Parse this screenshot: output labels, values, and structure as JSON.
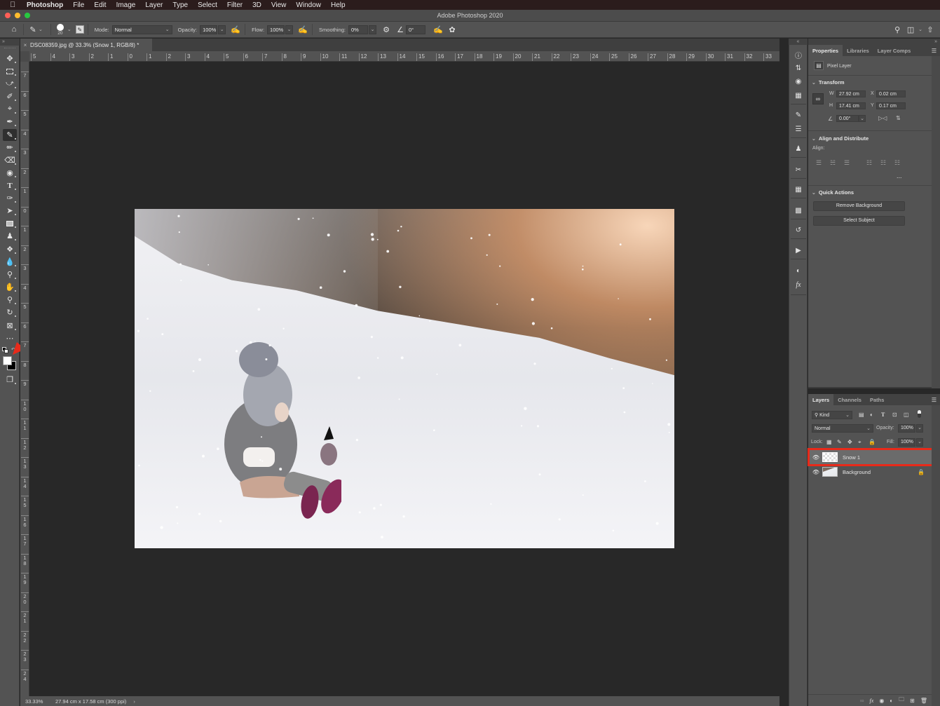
{
  "menubar": {
    "apple_icon": "apple-logo",
    "app_name": "Photoshop",
    "items": [
      "File",
      "Edit",
      "Image",
      "Layer",
      "Type",
      "Select",
      "Filter",
      "3D",
      "View",
      "Window",
      "Help"
    ]
  },
  "window": {
    "title": "Adobe Photoshop 2020",
    "traffic_lights": {
      "close": "#fe5f57",
      "minimize": "#febc2e",
      "zoom": "#28c840"
    }
  },
  "options_bar": {
    "brush_size": "20",
    "mode_label": "Mode:",
    "mode_value": "Normal",
    "opacity_label": "Opacity:",
    "opacity_value": "100%",
    "flow_label": "Flow:",
    "flow_value": "100%",
    "smoothing_label": "Smoothing:",
    "smoothing_value": "0%",
    "angle_value": "0°"
  },
  "document": {
    "tab_title": "DSC08359.jpg @ 33.3% (Snow 1, RGB/8) *",
    "close_glyph": "×"
  },
  "rulers": {
    "top": [
      "5",
      "4",
      "3",
      "2",
      "1",
      "0",
      "1",
      "2",
      "3",
      "4",
      "5",
      "6",
      "7",
      "8",
      "9",
      "10",
      "11",
      "12",
      "13",
      "14",
      "15",
      "16",
      "17",
      "18",
      "19",
      "20",
      "21",
      "22",
      "23",
      "24",
      "25",
      "26",
      "27",
      "28",
      "29",
      "30",
      "31",
      "32",
      "33"
    ],
    "left": [
      "7",
      "6",
      "5",
      "4",
      "3",
      "2",
      "1",
      "0",
      "1",
      "2",
      "3",
      "4",
      "5",
      "6",
      "7",
      "8",
      "9",
      "10",
      "11",
      "12",
      "13",
      "14",
      "15",
      "16",
      "17",
      "18",
      "19",
      "20",
      "21",
      "22",
      "23",
      "24"
    ]
  },
  "tools": [
    "move",
    "marquee",
    "lasso",
    "quick-select",
    "crop",
    "eyedropper",
    "brush",
    "history-brush",
    "eraser",
    "paint-bucket",
    "type",
    "pen",
    "path-select",
    "rectangle",
    "clone-stamp",
    "patch",
    "blur",
    "dodge",
    "hand",
    "zoom",
    "rotate-view",
    "frame",
    "more-tools",
    "default-colors",
    "foreground-background-colors",
    "screen-mode"
  ],
  "colors": {
    "foreground": "#ffffff",
    "background": "#000000",
    "annotation_red": "#e82a1a"
  },
  "status_bar": {
    "zoom": "33.33%",
    "doc_info": "27.94 cm x 17.58 cm (300 ppi)",
    "arrow": "›"
  },
  "properties_panel": {
    "tabs": [
      "Properties",
      "Libraries",
      "Layer Comps"
    ],
    "active_tab": "Properties",
    "layer_type": "Pixel Layer",
    "transform": {
      "title": "Transform",
      "w_label": "W",
      "w_value": "27.92 cm",
      "h_label": "H",
      "h_value": "17.41 cm",
      "x_label": "X",
      "x_value": "0.02 cm",
      "y_label": "Y",
      "y_value": "0.17 cm",
      "angle_value": "0.00°"
    },
    "align": {
      "title": "Align and Distribute",
      "align_label": "Align:",
      "more": "..."
    },
    "quick_actions": {
      "title": "Quick Actions",
      "buttons": [
        "Remove Background",
        "Select Subject"
      ]
    }
  },
  "layers_panel": {
    "tabs": [
      "Layers",
      "Channels",
      "Paths"
    ],
    "active_tab": "Layers",
    "filter_kind": "Kind",
    "blend_mode": "Normal",
    "opacity_label": "Opacity:",
    "opacity_value": "100%",
    "lock_label": "Lock:",
    "fill_label": "Fill:",
    "fill_value": "100%",
    "layers": [
      {
        "name": "Snow 1",
        "visible": true,
        "selected": true,
        "locked": false
      },
      {
        "name": "Background",
        "visible": true,
        "selected": false,
        "locked": true
      }
    ]
  }
}
